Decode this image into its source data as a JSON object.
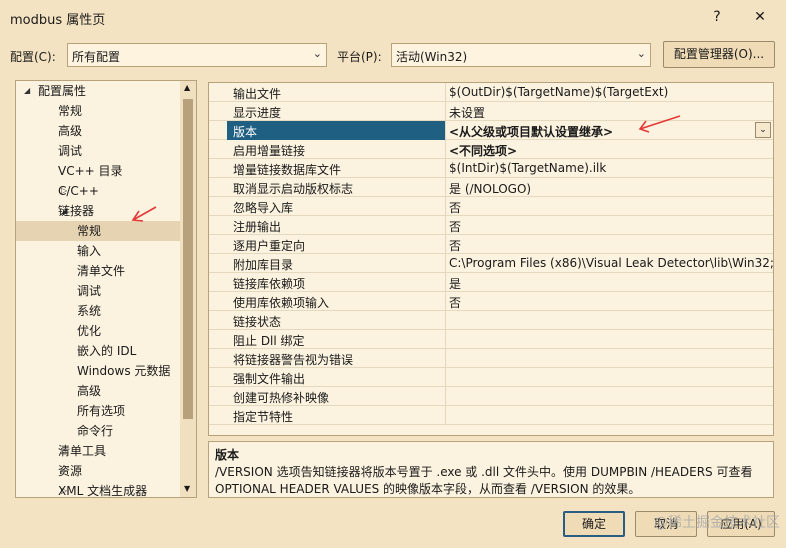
{
  "window": {
    "title": "modbus 属性页",
    "help": "?",
    "close": "✕"
  },
  "toolbar": {
    "config_label": "配置(C):",
    "config_value": "所有配置",
    "platform_label": "平台(P):",
    "platform_value": "活动(Win32)",
    "manager_button": "配置管理器(O)..."
  },
  "tree": {
    "items": [
      {
        "label": "配置属性",
        "expander": "open"
      },
      {
        "label": "常规"
      },
      {
        "label": "高级"
      },
      {
        "label": "调试"
      },
      {
        "label": "VC++ 目录"
      },
      {
        "label": "C/C++",
        "expander": "closed"
      },
      {
        "label": "链接器",
        "expander": "open"
      },
      {
        "label": "常规",
        "selected": true
      },
      {
        "label": "输入"
      },
      {
        "label": "清单文件"
      },
      {
        "label": "调试"
      },
      {
        "label": "系统"
      },
      {
        "label": "优化"
      },
      {
        "label": "嵌入的 IDL"
      },
      {
        "label": "Windows 元数据"
      },
      {
        "label": "高级"
      },
      {
        "label": "所有选项"
      },
      {
        "label": "命令行"
      },
      {
        "label": "清单工具",
        "expander": "closed"
      },
      {
        "label": "资源",
        "expander": "closed"
      },
      {
        "label": "XML 文档生成器",
        "expander": "closed"
      }
    ]
  },
  "grid": {
    "rows": [
      {
        "name": "输出文件",
        "value": "$(OutDir)$(TargetName)$(TargetExt)"
      },
      {
        "name": "显示进度",
        "value": "未设置"
      },
      {
        "name": "版本",
        "value": "<从父级或项目默认设置继承>",
        "selected": true,
        "bold": true
      },
      {
        "name": "启用增量链接",
        "value": "<不同选项>",
        "bold": true
      },
      {
        "name": "增量链接数据库文件",
        "value": "$(IntDir)$(TargetName).ilk"
      },
      {
        "name": "取消显示启动版权标志",
        "value": "是 (/NOLOGO)"
      },
      {
        "name": "忽略导入库",
        "value": "否"
      },
      {
        "name": "注册输出",
        "value": "否"
      },
      {
        "name": "逐用户重定向",
        "value": "否"
      },
      {
        "name": "附加库目录",
        "value": "C:\\Program Files (x86)\\Visual Leak Detector\\lib\\Win32;%"
      },
      {
        "name": "链接库依赖项",
        "value": "是"
      },
      {
        "name": "使用库依赖项输入",
        "value": "否"
      },
      {
        "name": "链接状态",
        "value": ""
      },
      {
        "name": "阻止 Dll 绑定",
        "value": ""
      },
      {
        "name": "将链接器警告视为错误",
        "value": ""
      },
      {
        "name": "强制文件输出",
        "value": ""
      },
      {
        "name": "创建可热修补映像",
        "value": ""
      },
      {
        "name": "指定节特性",
        "value": ""
      }
    ]
  },
  "description": {
    "title": "版本",
    "text": "/VERSION 选项告知链接器将版本号置于 .exe 或 .dll 文件头中。使用 DUMPBIN /HEADERS 可查看 OPTIONAL HEADER VALUES 的映像版本字段，从而查看 /VERSION 的效果。"
  },
  "buttons": {
    "ok": "确定",
    "cancel": "取消",
    "apply": "应用(A)"
  },
  "watermark": "@稀土掘金技术社区",
  "colors": {
    "background": "#f4e3c2",
    "selection": "#1f5f82",
    "annotation_arrow": "#e53935"
  }
}
